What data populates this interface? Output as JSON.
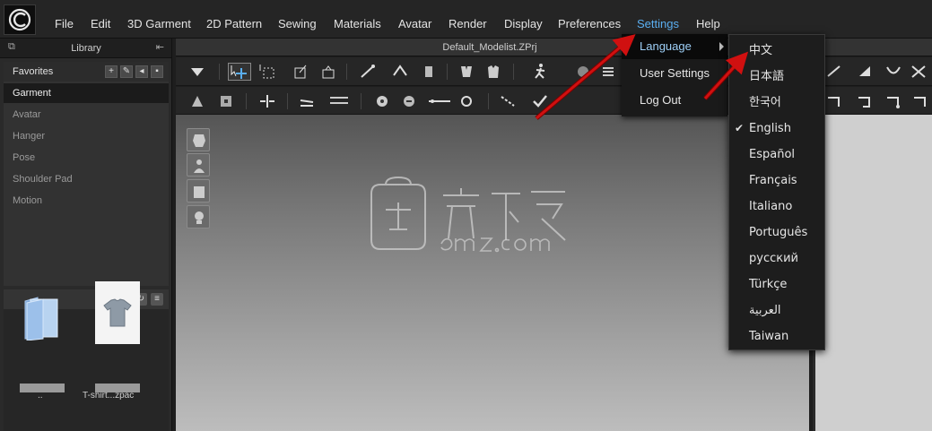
{
  "menubar": {
    "items": [
      "File",
      "Edit",
      "3D Garment",
      "2D Pattern",
      "Sewing",
      "Materials",
      "Avatar",
      "Render",
      "Display",
      "Preferences",
      "Settings",
      "Help"
    ],
    "active": "Settings"
  },
  "library": {
    "title": "Library",
    "items": [
      "Favorites",
      "Garment",
      "Avatar",
      "Hanger",
      "Pose",
      "Shoulder Pad",
      "Motion"
    ],
    "selected": "Garment",
    "files": [
      {
        "name": "..",
        "icon": "folder-icon"
      },
      {
        "name": "T-shirt...zpac",
        "icon": "tshirt-thumbnail"
      }
    ]
  },
  "document": {
    "tab_title": "Default_Modelist.ZPrj"
  },
  "settings_menu": {
    "items": [
      "Language",
      "User Settings",
      "Log Out"
    ],
    "highlighted": "Language"
  },
  "language_menu": {
    "items": [
      "中文",
      "日本語",
      "한국어",
      "English",
      "Español",
      "Français",
      "Italiano",
      "Português",
      "русский",
      "Türkçe",
      "العربية",
      "Taiwan"
    ],
    "checked": "English"
  },
  "colors": {
    "accent": "#5aaef0",
    "annotation_arrow": "#d01010",
    "menubar_bg": "#252525",
    "menu_bg": "#1d1d1d"
  }
}
